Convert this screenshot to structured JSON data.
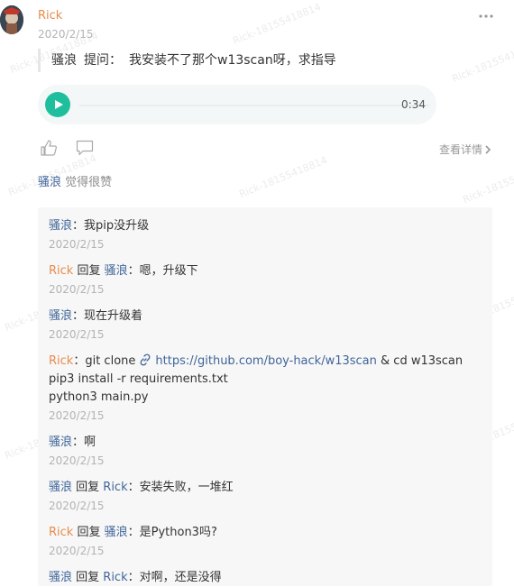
{
  "watermark": "Rick-18155418814",
  "post": {
    "author": "Rick",
    "date": "2020/2/15",
    "quote_user": "骚浪",
    "quote_label": "提问：",
    "quote_text": "我安装不了那个w13scan呀，求指导"
  },
  "audio": {
    "duration": "0:34",
    "progress": 0
  },
  "actions": {
    "detail_label": "查看详情"
  },
  "likes": {
    "user": "骚浪",
    "text": "觉得很赞"
  },
  "comments": [
    {
      "user": "骚浪",
      "sep": "：",
      "text": "我pip没升级",
      "date": "2020/2/15"
    },
    {
      "user": "Rick",
      "reply_word": " 回复 ",
      "reply_to": "骚浪",
      "sep": "：",
      "text": "嗯，升级下",
      "date": "2020/2/15"
    },
    {
      "user": "骚浪",
      "sep": "：",
      "text": "现在升级着",
      "date": "2020/2/15"
    },
    {
      "user": "Rick",
      "sep": "：",
      "text_before": "git clone",
      "link": "https://github.com/boy-hack/w13scan",
      "text_after": " & cd w13scan",
      "line2": "pip3 install -r requirements.txt",
      "line3": "python3 main.py",
      "date": "2020/2/15"
    },
    {
      "user": "骚浪",
      "sep": "：",
      "text": "啊",
      "date": "2020/2/15"
    },
    {
      "user": "骚浪",
      "reply_word": " 回复 ",
      "reply_to": "Rick",
      "sep": "：",
      "text": "安装失败，一堆红",
      "date": "2020/2/15"
    },
    {
      "user": "Rick",
      "reply_word": " 回复 ",
      "reply_to": "骚浪",
      "sep": "：",
      "text": "是Python3吗?",
      "date": "2020/2/15"
    },
    {
      "user": "骚浪",
      "reply_word": " 回复 ",
      "reply_to": "Rick",
      "sep": "：",
      "text": "对啊，还是没得",
      "date": ""
    }
  ],
  "colors": {
    "author": "#e88b4b",
    "user": "#406599",
    "play": "#1fbf9d"
  }
}
